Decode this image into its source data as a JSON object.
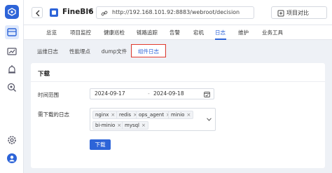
{
  "app": {
    "title": "FineBI6"
  },
  "address_bar": {
    "url": "http://192.168.101.92:8883/webroot/decision"
  },
  "header": {
    "compare_label": "项目对比"
  },
  "nav": {
    "items": [
      {
        "label": "总览"
      },
      {
        "label": "项目监控"
      },
      {
        "label": "健康巡检"
      },
      {
        "label": "链路追踪"
      },
      {
        "label": "告警"
      },
      {
        "label": "宕机"
      },
      {
        "label": "日志"
      },
      {
        "label": "维护"
      },
      {
        "label": "业务工具"
      }
    ],
    "active": "日志"
  },
  "subtabs": {
    "items": [
      {
        "label": "运维日志"
      },
      {
        "label": "性能埋点"
      },
      {
        "label": "dump文件"
      },
      {
        "label": "组件日志"
      }
    ],
    "selected": "组件日志"
  },
  "panel": {
    "title": "下载",
    "time_range_label": "时间范围",
    "start_date": "2024-09-17",
    "end_date": "2024-09-18",
    "logs_label": "需下载的日志",
    "logs": [
      "nginx",
      "redis",
      "ops_agent",
      "minio",
      "bi-minio",
      "mysql"
    ],
    "download_label": "下载"
  },
  "colors": {
    "accent": "#2d64d8",
    "highlight_box": "#e23b2e",
    "background": "#eef1f6"
  },
  "icons": {
    "sidebar": [
      "logo-icon",
      "monitor-icon",
      "chart-icon",
      "alarm-icon",
      "search-icon",
      "settings-icon",
      "user-icon"
    ]
  }
}
